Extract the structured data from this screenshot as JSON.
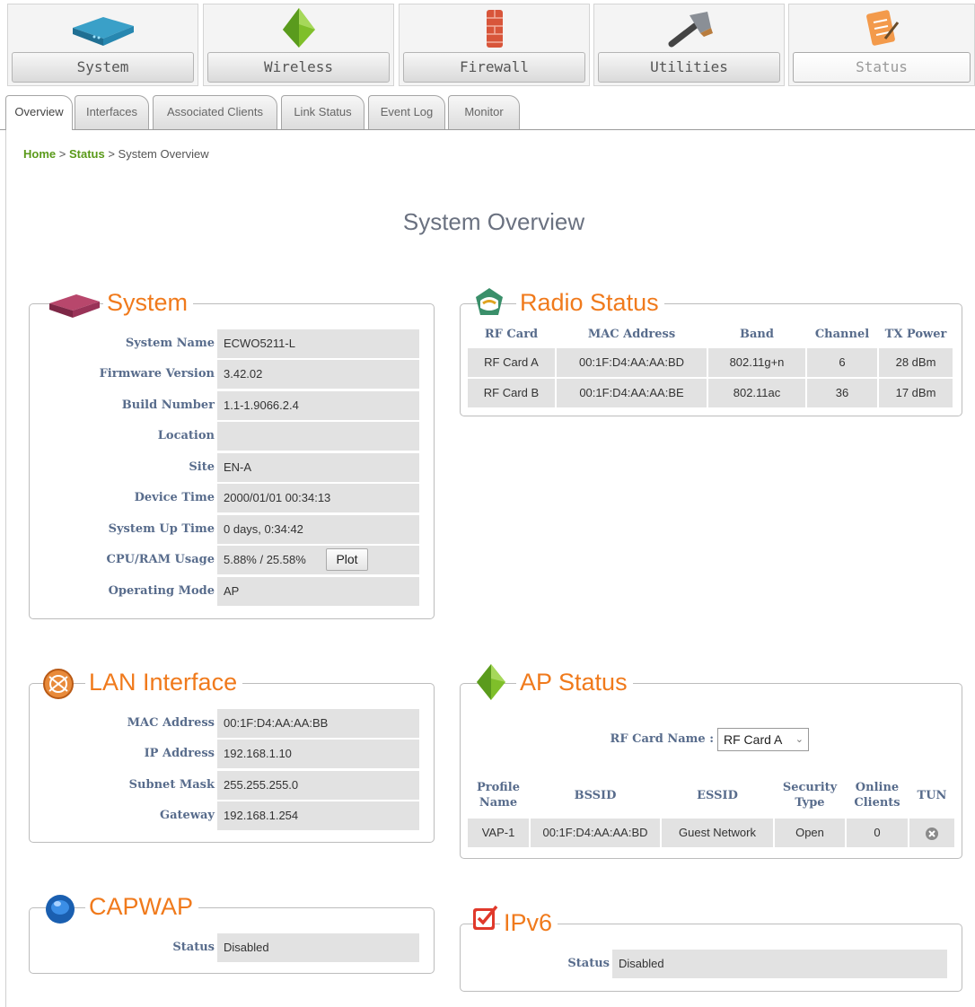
{
  "nav": [
    {
      "label": "System",
      "icon": "router-icon"
    },
    {
      "label": "Wireless",
      "icon": "wireless-icon"
    },
    {
      "label": "Firewall",
      "icon": "firewall-icon"
    },
    {
      "label": "Utilities",
      "icon": "hammer-icon"
    },
    {
      "label": "Status",
      "icon": "clipboard-icon",
      "active": true
    }
  ],
  "tabs": [
    "Overview",
    "Interfaces",
    "Associated Clients",
    "Link Status",
    "Event Log",
    "Monitor"
  ],
  "breadcrumb": {
    "home": "Home",
    "status": "Status",
    "current": "System Overview",
    "sep": ">"
  },
  "page_title": "System Overview",
  "system": {
    "title": "System",
    "rows": [
      {
        "label": "System Name",
        "value": "ECWO5211-L"
      },
      {
        "label": "Firmware Version",
        "value": "3.42.02"
      },
      {
        "label": "Build Number",
        "value": "1.1-1.9066.2.4"
      },
      {
        "label": "Location",
        "value": ""
      },
      {
        "label": "Site",
        "value": "EN-A"
      },
      {
        "label": "Device Time",
        "value": "2000/01/01 00:34:13"
      },
      {
        "label": "System Up Time",
        "value": "0 days, 0:34:42"
      },
      {
        "label": "CPU/RAM Usage",
        "value": "5.88% / 25.58%"
      },
      {
        "label": "Operating Mode",
        "value": "AP"
      }
    ],
    "plot_label": "Plot"
  },
  "radio": {
    "title": "Radio Status",
    "headers": [
      "RF Card",
      "MAC Address",
      "Band",
      "Channel",
      "TX Power"
    ],
    "rows": [
      [
        "RF Card A",
        "00:1F:D4:AA:AA:BD",
        "802.11g+n",
        "6",
        "28 dBm"
      ],
      [
        "RF Card B",
        "00:1F:D4:AA:AA:BE",
        "802.11ac",
        "36",
        "17 dBm"
      ]
    ]
  },
  "lan": {
    "title": "LAN Interface",
    "rows": [
      {
        "label": "MAC Address",
        "value": "00:1F:D4:AA:AA:BB"
      },
      {
        "label": "IP Address",
        "value": "192.168.1.10"
      },
      {
        "label": "Subnet Mask",
        "value": "255.255.255.0"
      },
      {
        "label": "Gateway",
        "value": "192.168.1.254"
      }
    ]
  },
  "ap": {
    "title": "AP Status",
    "rf_card_label": "RF Card Name :",
    "rf_card_value": "RF Card A",
    "headers": [
      [
        "Profile",
        "Name"
      ],
      [
        "BSSID"
      ],
      [
        "ESSID"
      ],
      [
        "Security",
        "Type"
      ],
      [
        "Online",
        "Clients"
      ],
      [
        "TUN"
      ]
    ],
    "rows": [
      [
        "VAP-1",
        "00:1F:D4:AA:AA:BD",
        "Guest Network",
        "Open",
        "0"
      ]
    ]
  },
  "capwap": {
    "title": "CAPWAP",
    "label": "Status",
    "value": "Disabled"
  },
  "ipv6": {
    "title": "IPv6",
    "label": "Status",
    "value": "Disabled"
  },
  "colors": {
    "accent": "#f07a1c",
    "label": "#586c8c",
    "crumb": "#5a9a1a",
    "cell": "#e2e2e2"
  }
}
